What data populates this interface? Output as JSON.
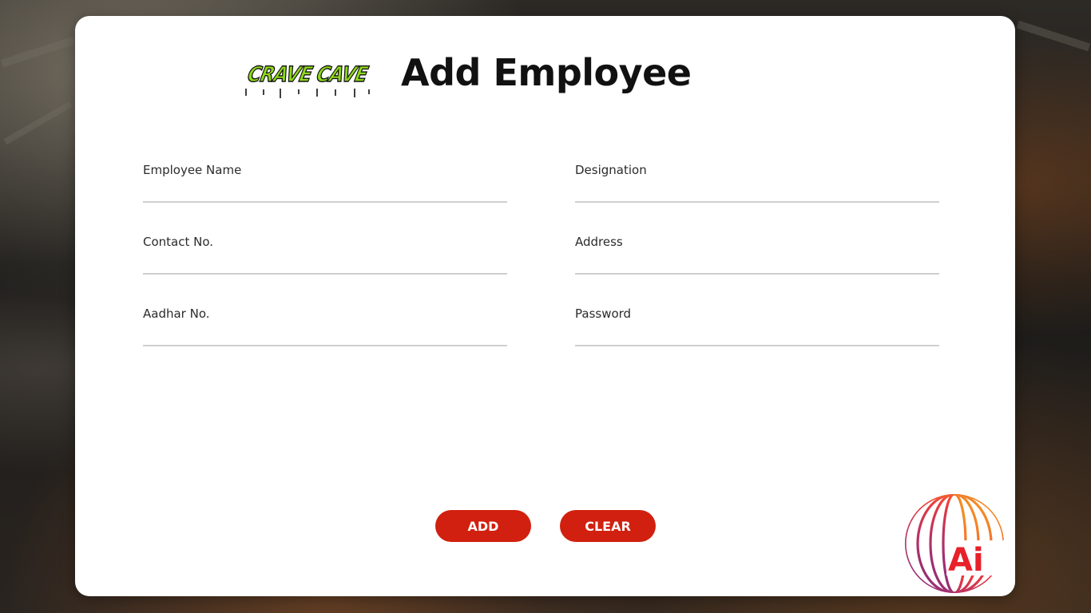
{
  "logo": {
    "text": "CRAVE CAVE",
    "color": "#8ed81a"
  },
  "page": {
    "title": "Add Employee"
  },
  "form": {
    "fields": [
      {
        "label": "Employee Name",
        "value": ""
      },
      {
        "label": "Designation",
        "value": ""
      },
      {
        "label": "Contact No.",
        "value": ""
      },
      {
        "label": "Address",
        "value": ""
      },
      {
        "label": "Aadhar No.",
        "value": ""
      },
      {
        "label": "Password",
        "value": ""
      }
    ]
  },
  "buttons": {
    "add": "ADD",
    "clear": "CLEAR"
  },
  "badge": {
    "text": "Ai",
    "accent": "#e8202a"
  },
  "colors": {
    "button": "#d1200f",
    "card": "#ffffff"
  }
}
